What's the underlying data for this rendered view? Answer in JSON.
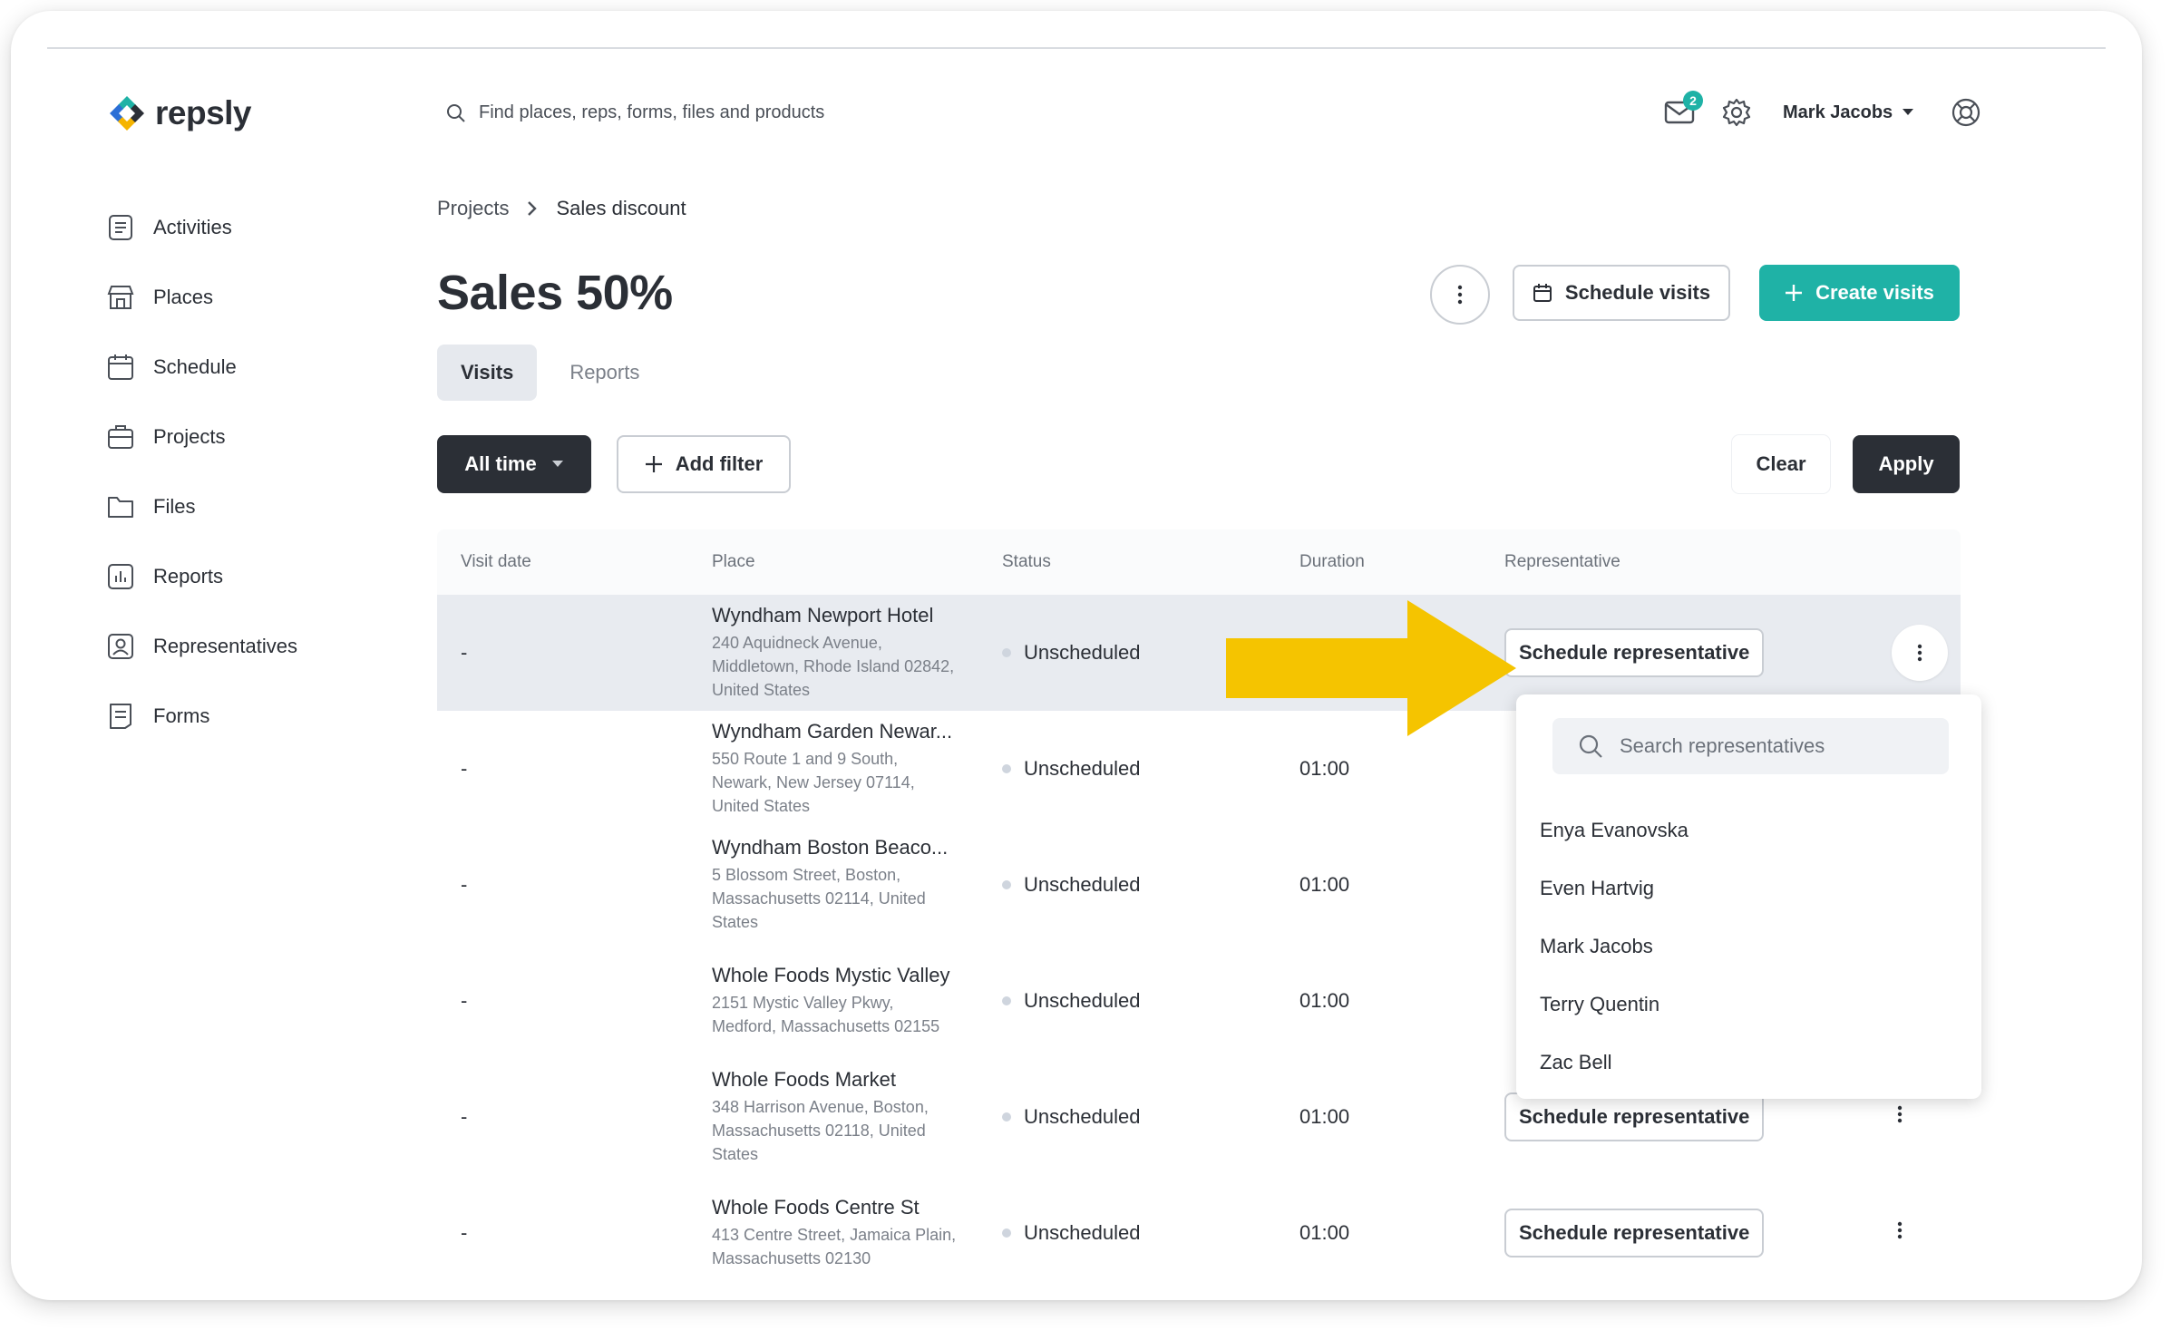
{
  "app": {
    "logo_text": "repsly"
  },
  "search": {
    "placeholder": "Find places, reps, forms, files and products"
  },
  "header": {
    "mail_count": "2",
    "user_name": "Mark Jacobs"
  },
  "sidebar": {
    "items": [
      {
        "label": "Activities",
        "icon": "clipboard-icon"
      },
      {
        "label": "Places",
        "icon": "store-icon"
      },
      {
        "label": "Schedule",
        "icon": "calendar-icon"
      },
      {
        "label": "Projects",
        "icon": "briefcase-icon"
      },
      {
        "label": "Files",
        "icon": "folder-icon"
      },
      {
        "label": "Reports",
        "icon": "chart-icon"
      },
      {
        "label": "Representatives",
        "icon": "person-icon"
      },
      {
        "label": "Forms",
        "icon": "form-icon"
      }
    ]
  },
  "breadcrumb": {
    "parent": "Projects",
    "current": "Sales discount"
  },
  "page": {
    "title": "Sales 50%",
    "schedule_visits_label": "Schedule visits",
    "create_visits_label": "Create visits"
  },
  "tabs": [
    {
      "label": "Visits",
      "active": true
    },
    {
      "label": "Reports",
      "active": false
    }
  ],
  "filters": {
    "time_label": "All time",
    "add_filter_label": "Add filter",
    "clear_label": "Clear",
    "apply_label": "Apply"
  },
  "table": {
    "columns": [
      "Visit date",
      "Place",
      "Status",
      "Duration",
      "Representative"
    ],
    "rows": [
      {
        "date": "-",
        "place": "Wyndham Newport Hotel",
        "address": "240 Aquidneck Avenue, Middletown, Rhode Island 02842, United States",
        "status": "Unscheduled",
        "duration": "",
        "rep": "Schedule representative"
      },
      {
        "date": "-",
        "place": "Wyndham Garden Newar...",
        "address": "550 Route 1 and 9 South, Newark, New Jersey 07114, United States",
        "status": "Unscheduled",
        "duration": "01:00",
        "rep": ""
      },
      {
        "date": "-",
        "place": "Wyndham Boston Beaco...",
        "address": "5 Blossom Street, Boston, Massachusetts 02114, United States",
        "status": "Unscheduled",
        "duration": "01:00",
        "rep": ""
      },
      {
        "date": "-",
        "place": "Whole Foods Mystic Valley",
        "address": "2151 Mystic Valley Pkwy, Medford, Massachusetts 02155",
        "status": "Unscheduled",
        "duration": "01:00",
        "rep": ""
      },
      {
        "date": "-",
        "place": "Whole Foods Market",
        "address": "348 Harrison Avenue, Boston, Massachusetts 02118, United States",
        "status": "Unscheduled",
        "duration": "01:00",
        "rep": "Schedule representative"
      },
      {
        "date": "-",
        "place": "Whole Foods Centre St",
        "address": "413 Centre Street, Jamaica Plain, Massachusetts 02130",
        "status": "Unscheduled",
        "duration": "01:00",
        "rep": "Schedule representative"
      }
    ]
  },
  "dropdown": {
    "search_placeholder": "Search representatives",
    "items": [
      "Enya Evanovska",
      "Even Hartvig",
      "Mark Jacobs",
      "Terry Quentin",
      "Zac Bell"
    ]
  },
  "colors": {
    "accent": "#1fb2a6",
    "dark": "#2b2f36",
    "arrow": "#f5c400"
  }
}
